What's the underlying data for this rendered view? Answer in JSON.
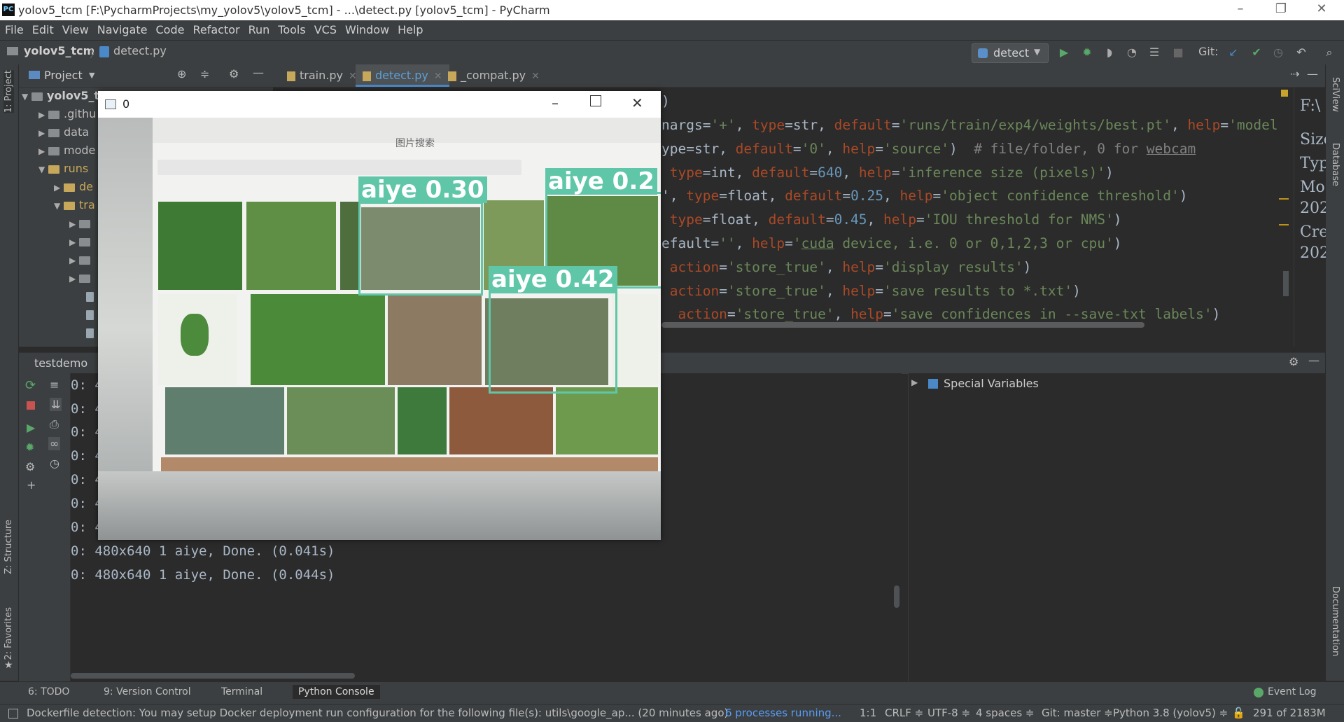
{
  "window": {
    "title": "yolov5_tcm [F:\\PycharmProjects\\my_yolov5\\yolov5_tcm] - ...\\detect.py [yolov5_tcm] - PyCharm"
  },
  "menu": [
    "File",
    "Edit",
    "View",
    "Navigate",
    "Code",
    "Refactor",
    "Run",
    "Tools",
    "VCS",
    "Window",
    "Help"
  ],
  "breadcrumb": {
    "project": "yolov5_tcm",
    "file": "detect.py"
  },
  "run_config": "detect",
  "git_label": "Git:",
  "project_panel": {
    "title": "Project",
    "items": [
      {
        "label": "yolov5_t",
        "arrow": "▼"
      },
      {
        "label": ".githu",
        "arrow": "▶"
      },
      {
        "label": "data",
        "arrow": "▶"
      },
      {
        "label": "mode",
        "arrow": "▶"
      },
      {
        "label": "runs",
        "arrow": "▼"
      },
      {
        "label": "de",
        "arrow": "▶"
      },
      {
        "label": "tra",
        "arrow": "▼"
      }
    ]
  },
  "editor_tabs": [
    {
      "label": "train.py"
    },
    {
      "label": "detect.py"
    },
    {
      "label": "_compat.py"
    }
  ],
  "code_lines": [
    {
      "html": ")"
    },
    {
      "html": "nargs=<span class='str'>'+'</span>, <span class='kw'>type</span>=str, <span class='kw'>default</span>=<span class='str'>'runs/train/exp4/weights/best.pt'</span>, <span class='kw'>help</span>=<span class='str'>'model</span>"
    },
    {
      "html": "ype=str, <span class='kw'>default</span>=<span class='str'>'0'</span>, <span class='kw'>help</span>=<span class='str'>'source'</span>)  <span class='cmt'># file/folder, 0 for <span class='ul'>webcam</span></span>"
    },
    {
      "html": " <span class='kw'>type</span>=int, <span class='kw'>default</span>=<span class='num'>640</span>, <span class='kw'>help</span>=<span class='str'>'inference size (pixels)'</span>)"
    },
    {
      "html": "', <span class='kw'>type</span>=float, <span class='kw'>default</span>=<span class='num'>0.25</span>, <span class='kw'>help</span>=<span class='str'>'object confidence threshold'</span>)"
    },
    {
      "html": " <span class='kw'>type</span>=float, <span class='kw'>default</span>=<span class='num'>0.45</span>, <span class='kw'>help</span>=<span class='str'>'IOU threshold for NMS'</span>)"
    },
    {
      "html": "efault=<span class='str'>''</span>, <span class='kw'>help</span>=<span class='str'>'<span class='ul'>cuda</span> device, i.e. 0 or 0,1,2,3 or cpu'</span>)"
    },
    {
      "html": " <span class='kw'>action</span>=<span class='str'>'store_true'</span>, <span class='kw'>help</span>=<span class='str'>'display results'</span>)"
    },
    {
      "html": " <span class='kw'>action</span>=<span class='str'>'store_true'</span>, <span class='kw'>help</span>=<span class='str'>'save results to *.txt'</span>)"
    },
    {
      "html": "  <span class='kw'>action</span>=<span class='str'>'store_true'</span>, <span class='kw'>help</span>=<span class='str'>'save confidences in --save-txt labels'</span>)"
    }
  ],
  "right_doc": [
    "F:\\",
    "Size",
    "Typ",
    "Mo",
    "202",
    "Cre",
    "202"
  ],
  "console": {
    "tab": "testdemo",
    "partial_lines": [
      "0: 4",
      "0: 4",
      "0: 4",
      "0: 4",
      "0: 4",
      "0: 4",
      "0: 4"
    ],
    "lines": [
      "0: 480x640 1 aiye, Done. (0.041s)",
      "0: 480x640 1 aiye, Done. (0.044s)"
    ]
  },
  "special_variables": "Special Variables",
  "image_window": {
    "title": "0",
    "detections": [
      {
        "label": "aiye 0.30"
      },
      {
        "label": "aiye 0.2"
      },
      {
        "label": "aiye 0.42"
      }
    ],
    "page_header": "图片搜索"
  },
  "bottom_tabs": [
    {
      "label": "6: TODO"
    },
    {
      "label": "9: Version Control"
    },
    {
      "label": "Terminal"
    },
    {
      "label": "Python Console"
    }
  ],
  "event_log": "Event Log",
  "left_stripe": {
    "project": "1: Project",
    "structure": "Z: Structure",
    "favorites": "2: Favorites"
  },
  "right_stripe": {
    "sciview": "SciView",
    "database": "Database",
    "documentation": "Documentation"
  },
  "status": {
    "message": "Dockerfile detection: You may setup Docker deployment run configuration for the following file(s): utils\\google_ap... (20 minutes ago)",
    "processes": "6 processes running...",
    "position": "1:1",
    "line_sep": "CRLF ≑",
    "encoding": "UTF-8 ≑",
    "indent": "4 spaces ≑",
    "git": "Git: master ≑",
    "interpreter": "Python 3.8 (yolov5) ≑",
    "memory": "291 of 2183M"
  },
  "colors": {
    "detection_box": "#5fc6a8",
    "accent": "#4a88c7",
    "ide_bg": "#2b2b2b"
  }
}
